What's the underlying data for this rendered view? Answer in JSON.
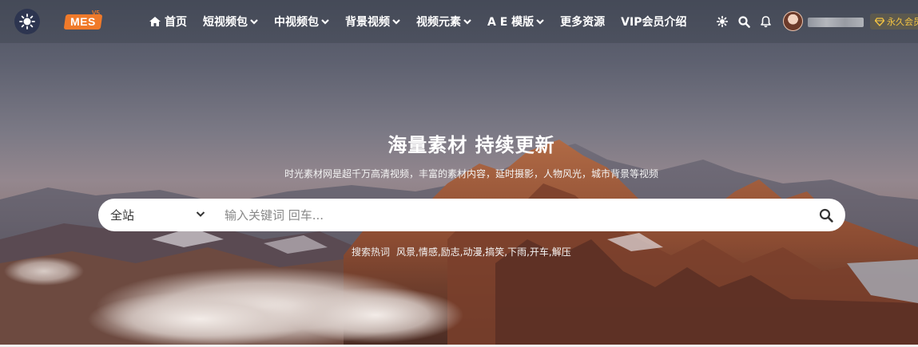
{
  "header": {
    "logo_text": "MES",
    "logo_version": "V5",
    "nav": [
      {
        "label": "首页",
        "icon": "home-icon",
        "dropdown": false
      },
      {
        "label": "短视频包",
        "dropdown": true
      },
      {
        "label": "中视频包",
        "dropdown": true
      },
      {
        "label": "背景视频",
        "dropdown": true
      },
      {
        "label": "视频元素",
        "dropdown": true
      },
      {
        "label": "A E 模版",
        "dropdown": true
      },
      {
        "label": "更多资源",
        "dropdown": false
      },
      {
        "label": "VIP会员介绍",
        "dropdown": false
      }
    ],
    "icons": [
      "theme-toggle-icon",
      "search-icon",
      "bell-icon"
    ],
    "vip_label": "永久会员"
  },
  "hero": {
    "title": "海量素材 持续更新",
    "subtitle": "时光素材网是超千万高清视频，丰富的素材内容，延时摄影，人物风光，城市背景等视频"
  },
  "search": {
    "scope": "全站",
    "placeholder": "输入关键词 回车..."
  },
  "hot_search": {
    "label": "搜索热词",
    "words": "风景,情感,励志,动漫,搞笑,下雨,开车,解压"
  },
  "colors": {
    "accent_orange": "#f07a2a",
    "vip_gold": "#f5c542",
    "text_white": "#ffffff"
  }
}
